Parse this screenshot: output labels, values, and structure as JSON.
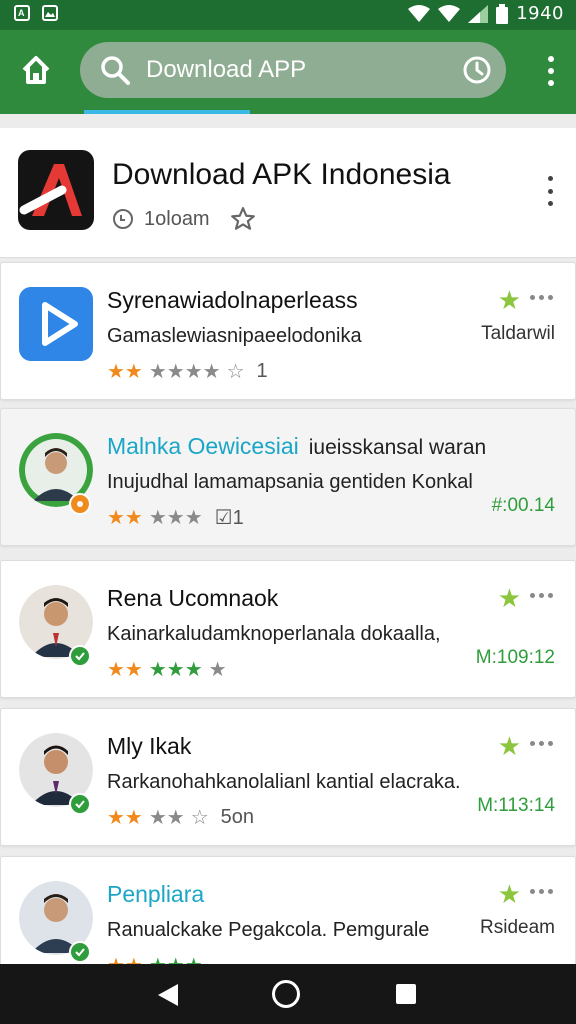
{
  "status_bar": {
    "time": "1940",
    "left_icons": [
      "a-notification-icon",
      "image-notification-icon"
    ],
    "right_icons": [
      "wifi-icon",
      "wifi-icon",
      "signal-icon",
      "battery-icon"
    ]
  },
  "appbar": {
    "search_text": "Download APP",
    "icons": [
      "home-icon",
      "search-icon",
      "history-icon",
      "more-vert-icon"
    ],
    "colors": {
      "appbar": "#2f8a3e",
      "status": "#1e6e31",
      "accent": "#39b9e6"
    }
  },
  "header": {
    "title": "Download APK Indonesia",
    "meta": "1oloam"
  },
  "items": [
    {
      "title": "Syrenawiadolnaperleass",
      "extra": "",
      "desc": "Gamaslewiasnipaeelodonika",
      "right": "Taldarwil",
      "stars": [
        "★★",
        "★★★★",
        "☆"
      ],
      "star_suffix": "1"
    },
    {
      "title": "Malnka Oewicesiai",
      "extra": "iueisskansal waran",
      "desc": "Inujudhal lamamapsania gentiden Konkal",
      "right": "#:00.14",
      "stars": [
        "★★",
        "★★★",
        ""
      ],
      "star_suffix": "☑1"
    },
    {
      "title": "Rena Ucomnaok",
      "extra": "",
      "desc": "Kainarkaludamknoperlanala dokaalla,",
      "right": "M:109:12",
      "stars": [
        "★★",
        "★★★",
        "★"
      ],
      "star_suffix": ""
    },
    {
      "title": "Mly Ikak",
      "extra": "",
      "desc": "Rarkanohahkanolalianl kantial elacraka.",
      "right": "M:113:14",
      "stars": [
        "★★",
        "★★",
        "☆"
      ],
      "star_suffix": "5on"
    },
    {
      "title": "Penpliara",
      "extra": "",
      "desc": "Ranualckake Pegakcola. Pemgurale",
      "right": "Rsideam",
      "stars": [
        "★★",
        "★★★",
        ""
      ],
      "star_suffix": ""
    }
  ]
}
